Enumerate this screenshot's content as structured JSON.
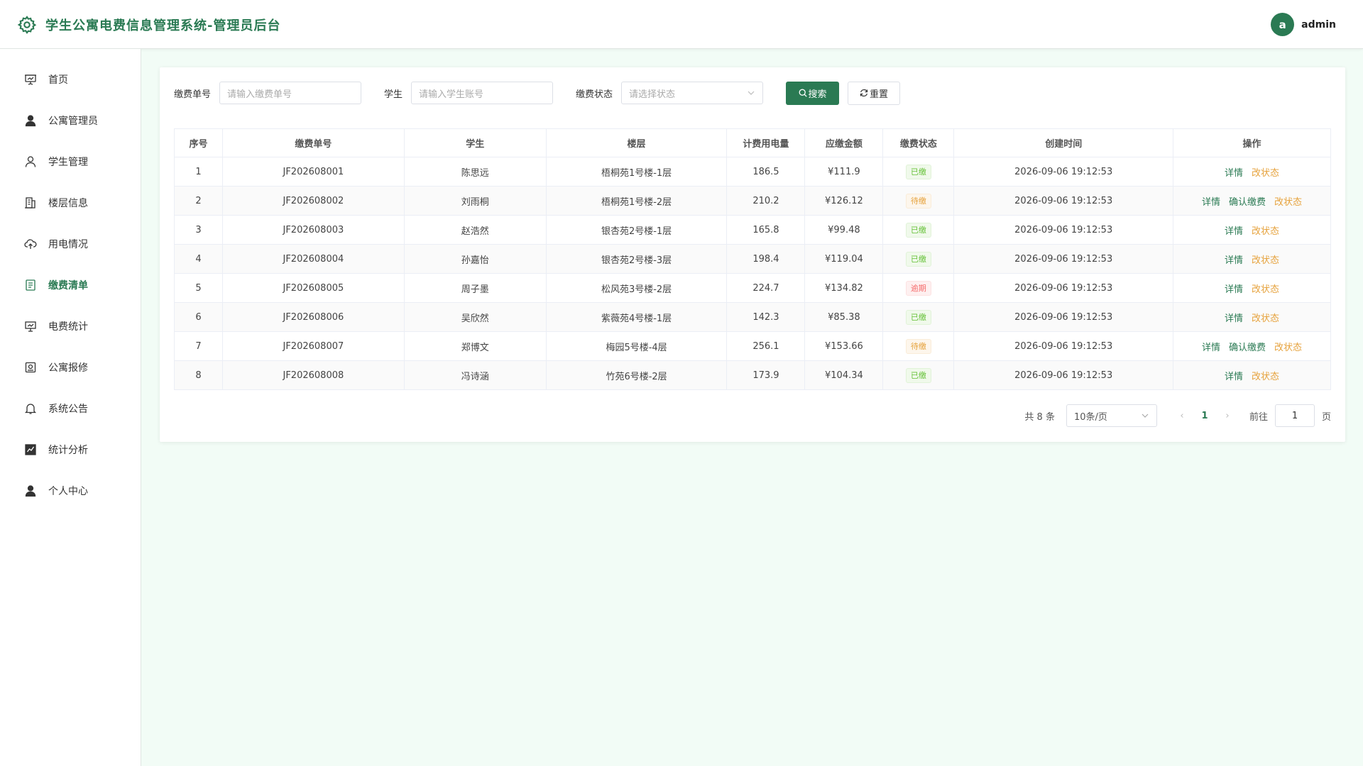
{
  "header": {
    "title": "学生公寓电费信息管理系统-管理员后台",
    "avatar_letter": "a",
    "username": "admin"
  },
  "sidebar": {
    "items": [
      {
        "label": "首页",
        "icon": "presentation-icon"
      },
      {
        "label": "公寓管理员",
        "icon": "user-filled-icon"
      },
      {
        "label": "学生管理",
        "icon": "user-outline-icon"
      },
      {
        "label": "楼层信息",
        "icon": "building-icon"
      },
      {
        "label": "用电情况",
        "icon": "cloud-upload-icon"
      },
      {
        "label": "缴费清单",
        "icon": "document-icon"
      },
      {
        "label": "电费统计",
        "icon": "board-icon"
      },
      {
        "label": "公寓报修",
        "icon": "repair-icon"
      },
      {
        "label": "系统公告",
        "icon": "bell-icon"
      },
      {
        "label": "统计分析",
        "icon": "chart-icon"
      },
      {
        "label": "个人中心",
        "icon": "user-filled-icon"
      }
    ],
    "active_label": "缴费清单"
  },
  "search": {
    "bill_no_label": "缴费单号",
    "bill_no_placeholder": "请输入缴费单号",
    "student_label": "学生",
    "student_placeholder": "请输入学生账号",
    "status_label": "缴费状态",
    "status_placeholder": "请选择状态",
    "search_button": "搜索",
    "reset_button": "重置"
  },
  "table": {
    "columns": [
      "序号",
      "缴费单号",
      "学生",
      "楼层",
      "计费用电量",
      "应缴金额",
      "缴费状态",
      "创建时间",
      "操作"
    ],
    "rows": [
      {
        "idx": "1",
        "bill_no": "JF202608001",
        "student": "陈思远",
        "floor": "梧桐苑1号楼-1层",
        "usage": "186.5",
        "amount": "¥111.9",
        "status": "已缴",
        "created": "2026-09-06 19:12:53"
      },
      {
        "idx": "2",
        "bill_no": "JF202608002",
        "student": "刘雨桐",
        "floor": "梧桐苑1号楼-2层",
        "usage": "210.2",
        "amount": "¥126.12",
        "status": "待缴",
        "created": "2026-09-06 19:12:53"
      },
      {
        "idx": "3",
        "bill_no": "JF202608003",
        "student": "赵浩然",
        "floor": "银杏苑2号楼-1层",
        "usage": "165.8",
        "amount": "¥99.48",
        "status": "已缴",
        "created": "2026-09-06 19:12:53"
      },
      {
        "idx": "4",
        "bill_no": "JF202608004",
        "student": "孙嘉怡",
        "floor": "银杏苑2号楼-3层",
        "usage": "198.4",
        "amount": "¥119.04",
        "status": "已缴",
        "created": "2026-09-06 19:12:53"
      },
      {
        "idx": "5",
        "bill_no": "JF202608005",
        "student": "周子墨",
        "floor": "松风苑3号楼-2层",
        "usage": "224.7",
        "amount": "¥134.82",
        "status": "逾期",
        "created": "2026-09-06 19:12:53"
      },
      {
        "idx": "6",
        "bill_no": "JF202608006",
        "student": "吴欣然",
        "floor": "紫薇苑4号楼-1层",
        "usage": "142.3",
        "amount": "¥85.38",
        "status": "已缴",
        "created": "2026-09-06 19:12:53"
      },
      {
        "idx": "7",
        "bill_no": "JF202608007",
        "student": "郑博文",
        "floor": "梅园5号楼-4层",
        "usage": "256.1",
        "amount": "¥153.66",
        "status": "待缴",
        "created": "2026-09-06 19:12:53"
      },
      {
        "idx": "8",
        "bill_no": "JF202608008",
        "student": "冯诗涵",
        "floor": "竹苑6号楼-2层",
        "usage": "173.9",
        "amount": "¥104.34",
        "status": "已缴",
        "created": "2026-09-06 19:12:53"
      }
    ],
    "actions": {
      "detail": "详情",
      "confirm": "确认缴费",
      "change": "改状态"
    }
  },
  "pagination": {
    "total_text": "共 8 条",
    "page_size": "10条/页",
    "current_page": "1",
    "goto_label": "前往",
    "goto_value": "1",
    "page_suffix": "页"
  },
  "colors": {
    "primary": "#2a7a53",
    "background": "#f2fcf6",
    "paid": "#67c23a",
    "pending": "#e6a23c",
    "overdue": "#f56c6c"
  }
}
